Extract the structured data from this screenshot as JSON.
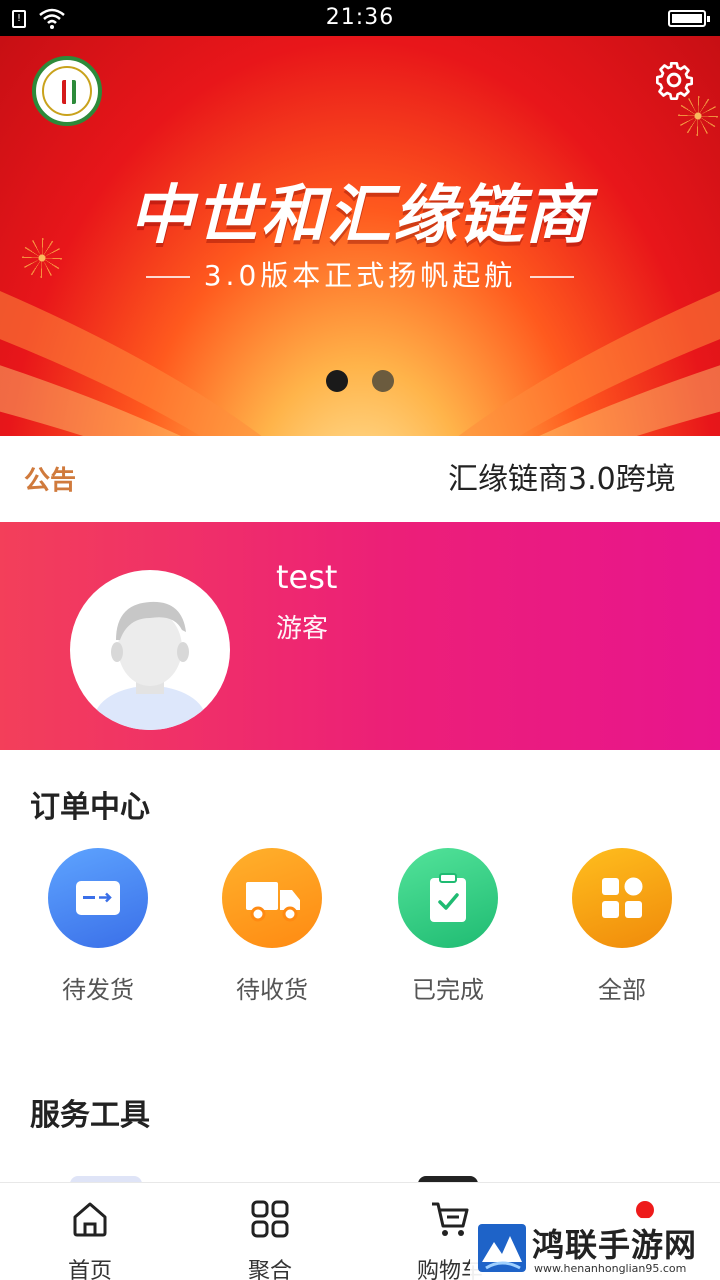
{
  "status_bar": {
    "time": "21:36"
  },
  "banner": {
    "headline": "中世和汇缘链商",
    "subline": "3.0版本正式扬帆起航",
    "slide_count": 2,
    "active_slide": 1
  },
  "notice": {
    "label": "公告",
    "text": "汇缘链商3.0跨境"
  },
  "profile": {
    "name": "test",
    "role": "游客"
  },
  "order_center": {
    "title": "订单中心",
    "items": [
      {
        "label": "待发货",
        "icon": "pending-shipment-icon",
        "color": "#3a6fe8"
      },
      {
        "label": "待收货",
        "icon": "truck-icon",
        "color": "#ff8a12"
      },
      {
        "label": "已完成",
        "icon": "clipboard-check-icon",
        "color": "#1fbb72"
      },
      {
        "label": "全部",
        "icon": "grid-icon",
        "color": "#f08a0a"
      }
    ]
  },
  "service_tools": {
    "title": "服务工具"
  },
  "tabbar": {
    "items": [
      {
        "label": "首页",
        "icon": "home-icon"
      },
      {
        "label": "聚合",
        "icon": "grid-icon"
      },
      {
        "label": "购物车",
        "icon": "cart-icon"
      },
      {
        "label": "",
        "icon": "profile-icon"
      }
    ]
  },
  "watermark": {
    "name": "鸿联手游网",
    "url": "www.henanhonglian95.com"
  },
  "colors": {
    "notice_label": "#d07a3c",
    "profile_gradient_start": "#f33f5a",
    "profile_gradient_end": "#e8158d",
    "badge": "#ee1a1a"
  }
}
